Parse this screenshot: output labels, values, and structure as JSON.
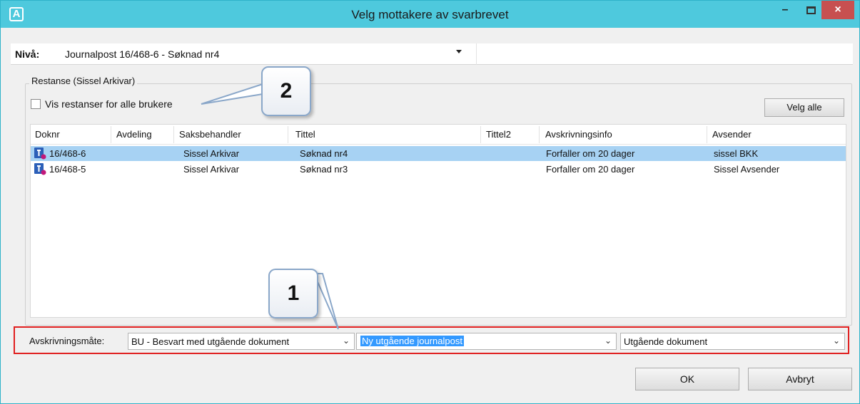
{
  "window": {
    "title": "Velg mottakere av svarbrevet",
    "app_icon": "A"
  },
  "controls": {
    "minimize": "–",
    "maximize": "",
    "close": "×"
  },
  "level": {
    "label": "Nivå:",
    "value": "Journalpost 16/468-6 - Søknad nr4"
  },
  "group": {
    "legend": "Restanse (Sissel Arkivar)"
  },
  "checkbox": {
    "label": "Vis restanser for alle brukere",
    "checked": false
  },
  "buttons": {
    "select_all": "Velg alle",
    "ok": "OK",
    "cancel": "Avbryt"
  },
  "table": {
    "columns": [
      "Doknr",
      "Avdeling",
      "Saksbehandler",
      "Tittel",
      "Tittel2",
      "Avskrivningsinfo",
      "Avsender"
    ],
    "rows": [
      {
        "doknr": "16/468-6",
        "avdeling": "",
        "saksbehandler": "Sissel Arkivar",
        "tittel": "Søknad nr4",
        "tittel2": "",
        "avskrivningsinfo": "Forfaller om 20 dager",
        "avsender": "sissel BKK",
        "selected": true
      },
      {
        "doknr": "16/468-5",
        "avdeling": "",
        "saksbehandler": "Sissel Arkivar",
        "tittel": "Søknad nr3",
        "tittel2": "",
        "avskrivningsinfo": "Forfaller om 20 dager",
        "avsender": "Sissel Avsender",
        "selected": false
      }
    ]
  },
  "bottom": {
    "label": "Avskrivningsmåte:",
    "combo1": "BU - Besvart med utgående dokument",
    "combo2": "Ny utgående journalpost",
    "combo3": "Utgående dokument"
  },
  "callouts": {
    "one": "1",
    "two": "2"
  },
  "colors": {
    "titlebar": "#4ec9dd",
    "close": "#c75050",
    "highlight_border": "#e02020",
    "selection": "#a7d2f3"
  }
}
